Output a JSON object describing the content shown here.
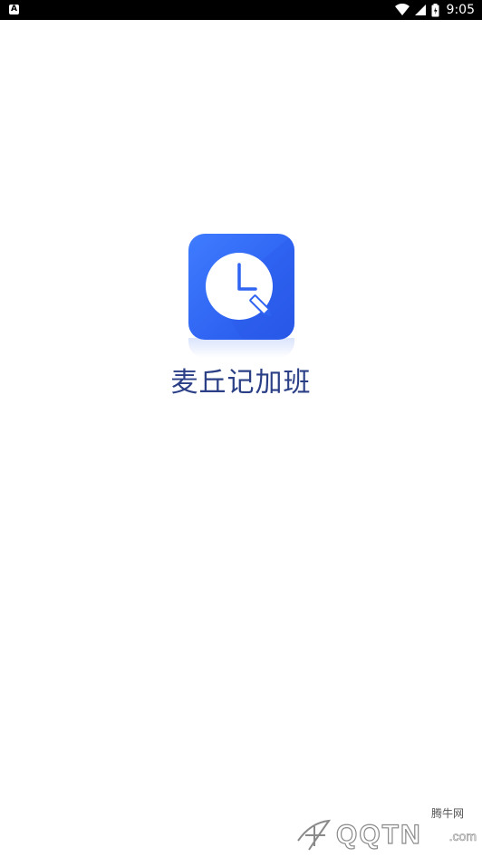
{
  "status_bar": {
    "left_icon": "A",
    "time": "9:05",
    "icons": [
      "wifi-icon",
      "signal-icon",
      "battery-icon"
    ]
  },
  "splash": {
    "app_name": "麦丘记加班",
    "icon": "clock-pencil-icon",
    "brand_color": "#2f64f2"
  },
  "watermark": {
    "text": "QQTN",
    "suffix": ".com",
    "cn_text": "腾牛网"
  }
}
